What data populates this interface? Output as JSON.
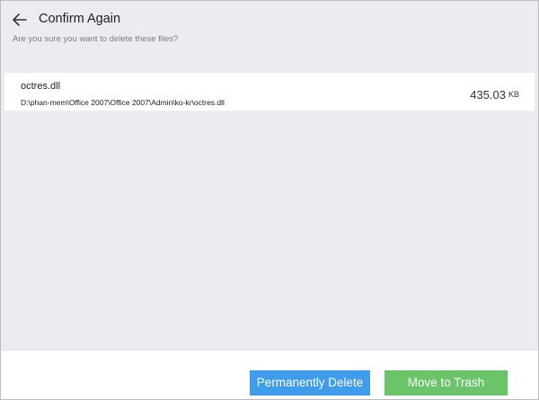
{
  "dialog": {
    "title": "Confirm Again",
    "subtitle": "Are you sure you want to delete these files?"
  },
  "files": [
    {
      "name": "octres.dll",
      "path": "D:\\phan-mem\\Office 2007\\Office 2007\\Admin\\ko-kr\\octres.dll",
      "size": "435.03",
      "unit": "KB"
    }
  ],
  "buttons": {
    "permanently_delete": "Permanently Delete",
    "move_to_trash": "Move to Trash"
  },
  "colors": {
    "delete_button": "#3e9cea",
    "trash_button": "#6cc46a",
    "background": "#ebecef"
  },
  "icons": {
    "back": "arrow-left"
  }
}
